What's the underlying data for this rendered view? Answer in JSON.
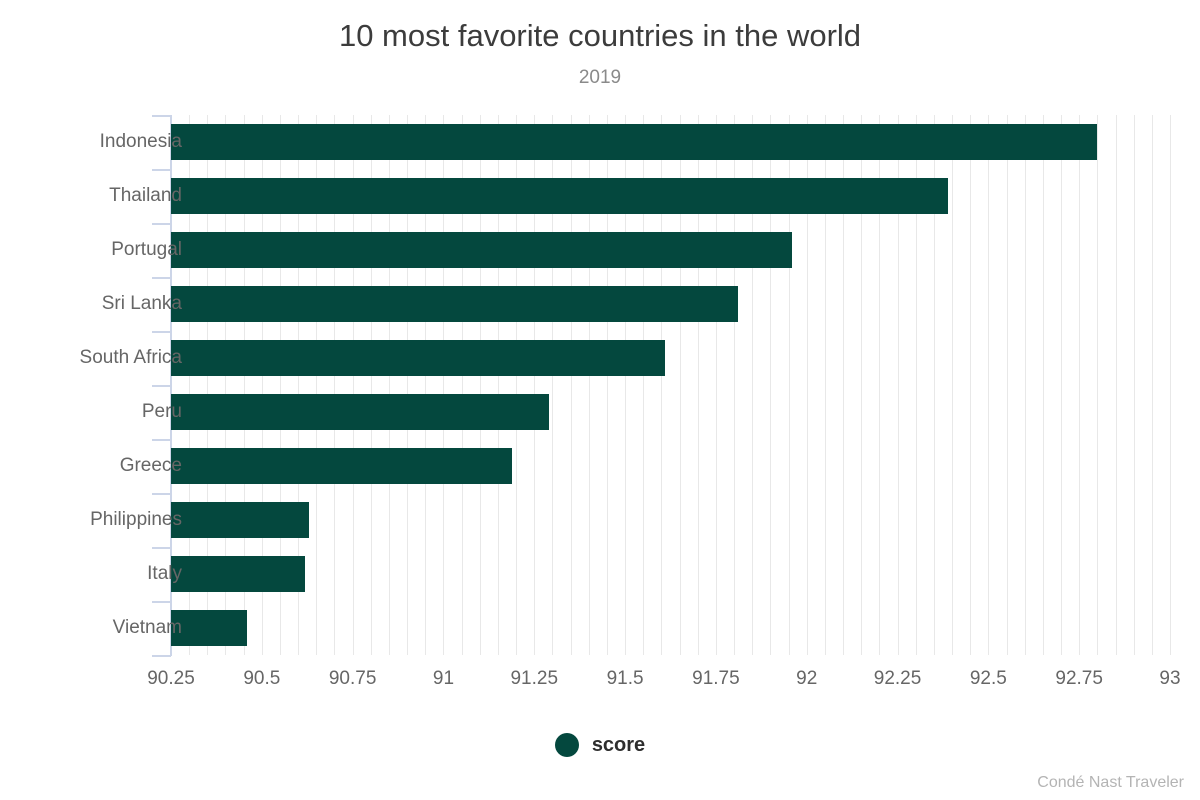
{
  "chart_data": {
    "type": "bar",
    "orientation": "horizontal",
    "title": "10 most favorite countries in the world",
    "subtitle": "2019",
    "xlabel": "",
    "ylabel": "",
    "categories": [
      "Indonesia",
      "Thailand",
      "Portugal",
      "Sri Lanka",
      "South Africa",
      "Peru",
      "Greece",
      "Philippines",
      "Italy",
      "Vietnam"
    ],
    "values": [
      92.8,
      92.39,
      91.96,
      91.81,
      91.61,
      91.29,
      91.19,
      90.63,
      90.62,
      90.46
    ],
    "series": [
      {
        "name": "score",
        "values": [
          92.8,
          92.39,
          91.96,
          91.81,
          91.61,
          91.29,
          91.19,
          90.63,
          90.62,
          90.46
        ],
        "color": "#04483e"
      }
    ],
    "xlim": [
      90.0,
      93.0
    ],
    "axis_start": 90.25,
    "x_ticks": [
      "90.25",
      "90.5",
      "90.75",
      "91",
      "91.25",
      "91.5",
      "91.75",
      "92",
      "92.25",
      "92.5",
      "92.75",
      "93"
    ],
    "x_tick_values": [
      90.25,
      90.5,
      90.75,
      91,
      91.25,
      91.5,
      91.75,
      92,
      92.25,
      92.5,
      92.75,
      93
    ],
    "grid": true,
    "grid_step": 0.05,
    "legend": {
      "position": "bottom",
      "entries": [
        {
          "label": "score",
          "color": "#04483e"
        }
      ]
    },
    "colors": {
      "bar": "#04483e",
      "gridline": "#e8e8e8",
      "axis": "#ccd5e8",
      "title_text": "#3c3c3c",
      "subtitle_text": "#8a8a8a",
      "tick_text": "#666666",
      "legend_text": "#2e2e2e",
      "credit_text": "#b4b4b4",
      "background": "#ffffff"
    }
  },
  "legend": {
    "label": "score"
  },
  "footer": {
    "credit": "Condé Nast Traveler"
  }
}
